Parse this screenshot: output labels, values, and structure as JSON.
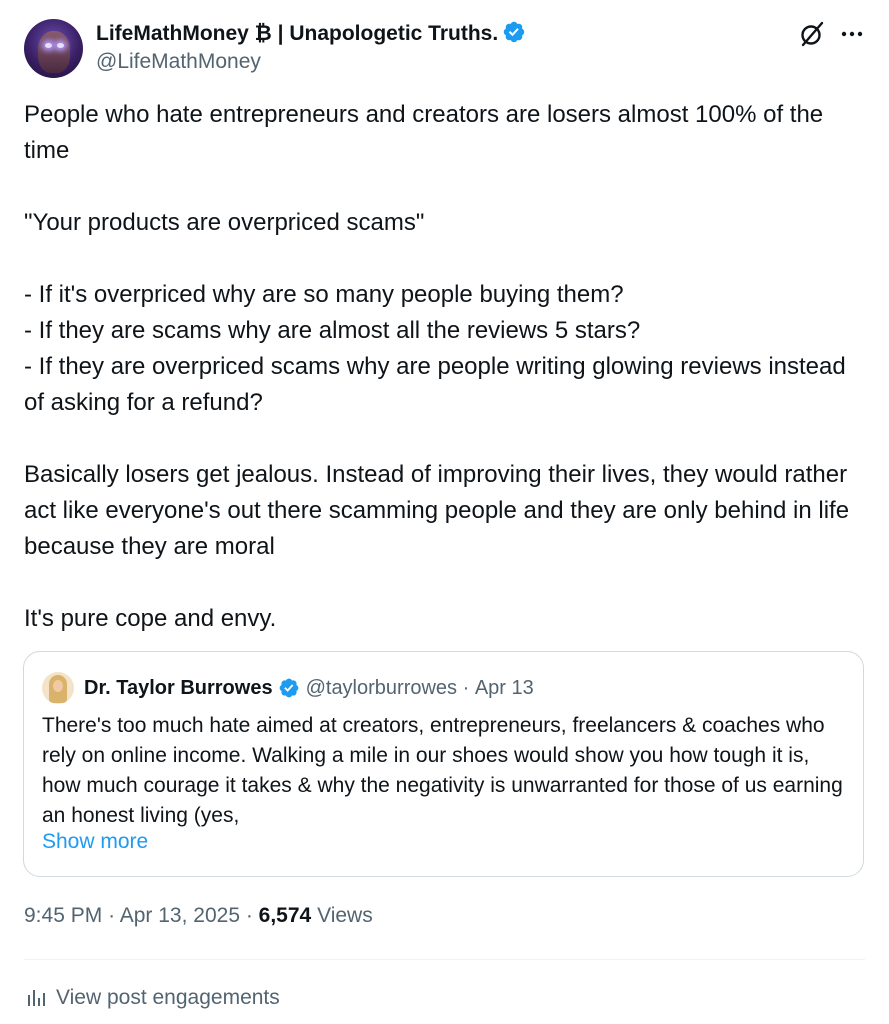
{
  "author": {
    "display_name": "LifeMathMoney ₿ | Unapologetic Truths.",
    "handle": "@LifeMathMoney"
  },
  "icons": {
    "verified": "verified-badge-icon",
    "grok": "grok-icon",
    "more": "more-options-icon",
    "analytics": "analytics-icon"
  },
  "colors": {
    "accent": "#1d9bf0",
    "secondary_text": "#536471",
    "border": "#cfd9de"
  },
  "post": {
    "paragraphs": [
      "People who hate entrepreneurs and creators are losers almost 100% of the time",
      "\"Your products are overpriced scams\"",
      "- If it's overpriced why are so many people buying them?\n- If they are scams why are almost all the reviews 5 stars?\n- If they are overpriced scams why are people writing glowing reviews instead of asking for a refund?",
      "Basically losers get jealous. Instead of improving their lives, they would rather act like everyone's out there scamming people and they are only behind in life because they are moral",
      "It's pure cope and envy."
    ]
  },
  "quoted_post": {
    "display_name": "Dr. Taylor Burrowes",
    "handle": "@taylorburrowes",
    "date": "Apr 13",
    "text": "There's too much hate aimed at creators, entrepreneurs, freelancers & coaches who rely on online income. Walking a mile in our shoes would show you how tough it is, how much courage it takes & why the negativity is unwarranted for those of us earning an honest living (yes,",
    "show_more": "Show more"
  },
  "meta": {
    "time": "9:45 PM",
    "date": "Apr 13, 2025",
    "views_count": "6,574",
    "views_label": "Views"
  },
  "engagements_label": "View post engagements"
}
